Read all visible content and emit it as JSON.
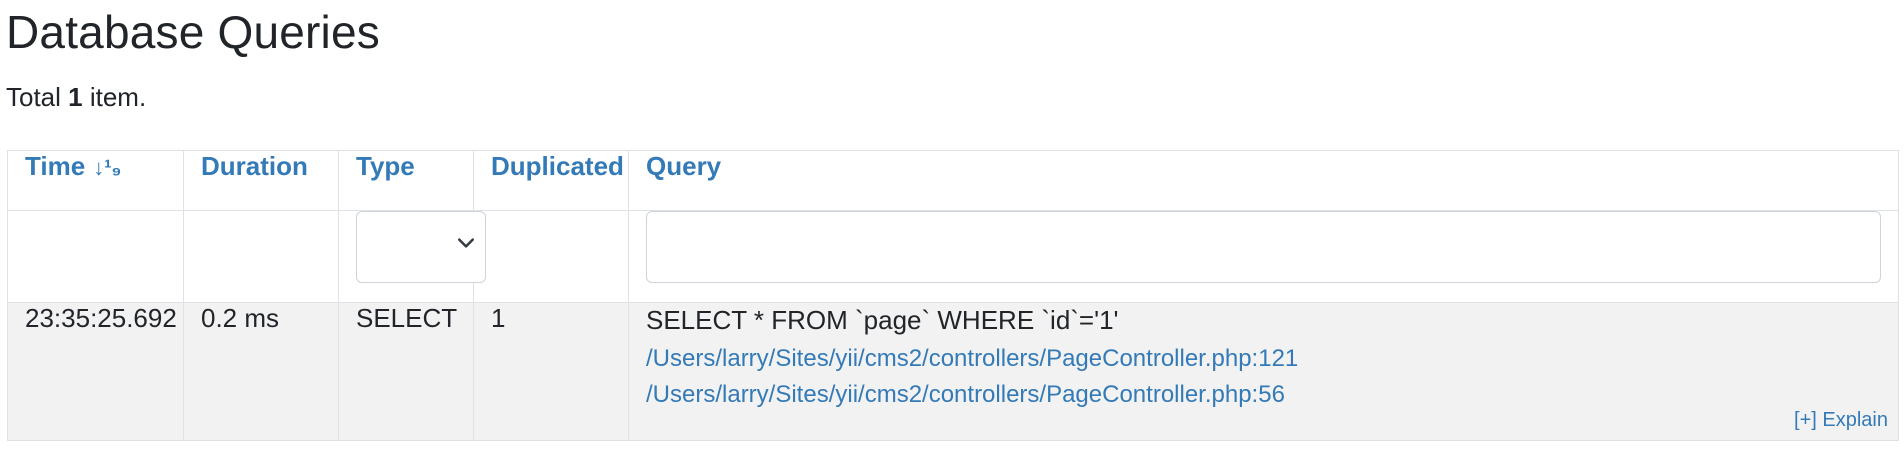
{
  "page": {
    "title": "Database Queries",
    "summary_prefix": "Total ",
    "summary_count": "1",
    "summary_suffix": " item."
  },
  "table": {
    "headers": {
      "time": "Time",
      "duration": "Duration",
      "type": "Type",
      "duplicated": "Duplicated",
      "query": "Query"
    },
    "sort_icon": "↓¹₉",
    "filters": {
      "type_selected": "",
      "query_value": ""
    },
    "rows": [
      {
        "time": "23:35:25.692",
        "duration": "0.2 ms",
        "type": "SELECT",
        "duplicated": "1",
        "query": "SELECT * FROM `page` WHERE `id`='1'",
        "trace": [
          "/Users/larry/Sites/yii/cms2/controllers/PageController.php:121",
          "/Users/larry/Sites/yii/cms2/controllers/PageController.php:56"
        ],
        "explain_label": "[+] Explain"
      }
    ]
  },
  "colors": {
    "link": "#337ab7",
    "text": "#212529",
    "row_bg": "#f2f2f2",
    "border": "#dee2e6"
  }
}
